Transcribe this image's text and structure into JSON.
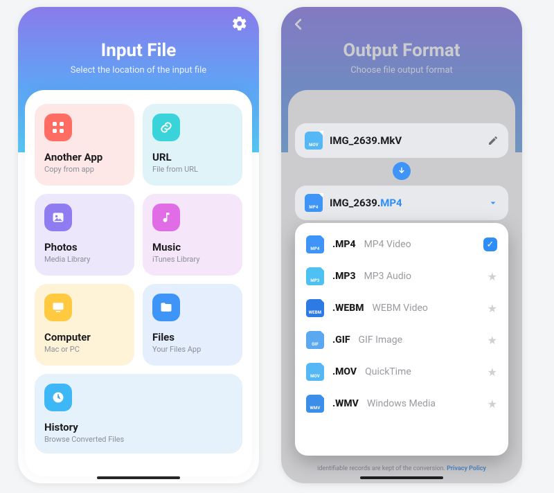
{
  "left": {
    "title": "Input File",
    "subtitle": "Select the location of the input file",
    "tiles": {
      "another_app": {
        "title": "Another App",
        "sub": "Copy from app"
      },
      "url": {
        "title": "URL",
        "sub": "File from URL"
      },
      "photos": {
        "title": "Photos",
        "sub": "Media Library"
      },
      "music": {
        "title": "Music",
        "sub": "iTunes Library"
      },
      "computer": {
        "title": "Computer",
        "sub": "Mac or PC"
      },
      "files": {
        "title": "Files",
        "sub": "Your Files App"
      },
      "history": {
        "title": "History",
        "sub": "Browse Converted Files"
      }
    }
  },
  "right": {
    "title": "Output Format",
    "subtitle": "Choose file output format",
    "source": {
      "name": "IMG_2639.MkV",
      "badge": "MOV"
    },
    "target": {
      "name_base": "IMG_2639.",
      "name_ext": "MP4",
      "badge": "MP4"
    },
    "options": [
      {
        "badge": "MP4",
        "ext": ".MP4",
        "desc": "MP4 Video",
        "selected": true
      },
      {
        "badge": "MP3",
        "ext": ".MP3",
        "desc": "MP3 Audio",
        "selected": false
      },
      {
        "badge": "WEBM",
        "ext": ".WEBM",
        "desc": "WEBM Video",
        "selected": false
      },
      {
        "badge": "GIF",
        "ext": ".GIF",
        "desc": "GIF Image",
        "selected": false
      },
      {
        "badge": "MOV",
        "ext": ".MOV",
        "desc": "QuickTime",
        "selected": false
      },
      {
        "badge": "WMV",
        "ext": ".WMV",
        "desc": "Windows Media",
        "selected": false
      }
    ],
    "footer_note": "identifiable records are kept of the conversion.",
    "footer_link": "Privacy Policy"
  }
}
